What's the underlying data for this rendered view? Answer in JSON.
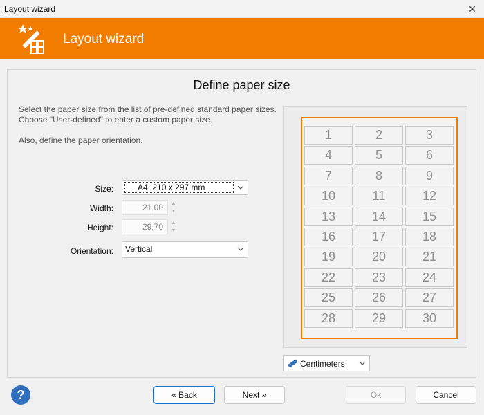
{
  "window": {
    "title": "Layout wizard",
    "close_glyph": "✕"
  },
  "header": {
    "title": "Layout wizard",
    "icon": "magic-wand-icon",
    "accent": "#f17c00"
  },
  "page": {
    "title": "Define paper size",
    "description_line1": "Select the paper size from the list of pre-defined standard paper sizes.",
    "description_line2": "Choose \"User-defined\" to enter a custom paper size.",
    "description_line3": "Also, define the paper orientation."
  },
  "form": {
    "size_label": "Size:",
    "size_value": "A4, 210 x 297 mm",
    "width_label": "Width:",
    "width_value": "21,00",
    "height_label": "Height:",
    "height_value": "29,70",
    "orientation_label": "Orientation:",
    "orientation_value": "Vertical"
  },
  "preview": {
    "cells": [
      "1",
      "2",
      "3",
      "4",
      "5",
      "6",
      "7",
      "8",
      "9",
      "10",
      "11",
      "12",
      "13",
      "14",
      "15",
      "16",
      "17",
      "18",
      "19",
      "20",
      "21",
      "22",
      "23",
      "24",
      "25",
      "26",
      "27",
      "28",
      "29",
      "30"
    ]
  },
  "units": {
    "value": "Centimeters",
    "icon": "ruler-icon"
  },
  "buttons": {
    "help_icon": "help-icon",
    "back": "« Back",
    "next": "Next »",
    "ok": "Ok",
    "cancel": "Cancel"
  }
}
